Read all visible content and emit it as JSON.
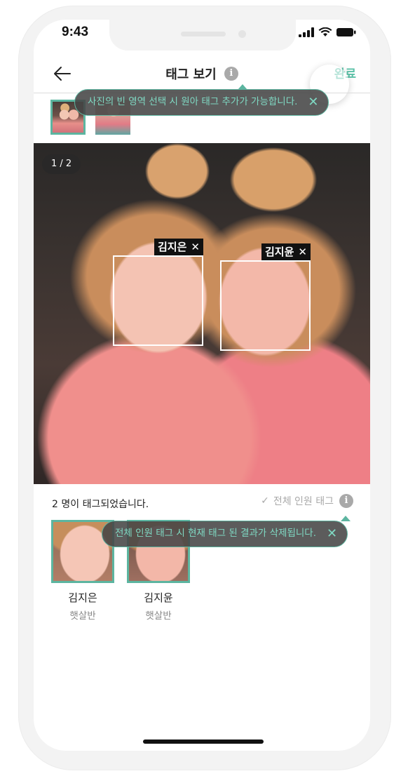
{
  "status_bar": {
    "time": "9:43"
  },
  "header": {
    "title": "태그 보기",
    "info": "i",
    "done": "완료"
  },
  "tooltips": {
    "top": "사진의 빈 영역 선택 시 원아 태그 추가가 가능합니다.",
    "bottom": "전체 인원 태그 시 현재 태그 된 결과가 삭제됩니다.",
    "close_glyph": "✕"
  },
  "photo": {
    "counter": "1 / 2",
    "tags": [
      {
        "name": "김지은",
        "remove": "✕"
      },
      {
        "name": "김지윤",
        "remove": "✕"
      }
    ]
  },
  "summary": {
    "tagged_count": "2 명이 태그되었습니다.",
    "check": "✓",
    "tag_all": "전체 인원 태그",
    "info": "i"
  },
  "people": [
    {
      "name": "김지은",
      "class": "햇살반"
    },
    {
      "name": "김지윤",
      "class": "햇살반"
    }
  ],
  "colors": {
    "accent": "#5cb5a0",
    "accent_text": "#5cc2a8",
    "muted": "#a9a9a9"
  }
}
